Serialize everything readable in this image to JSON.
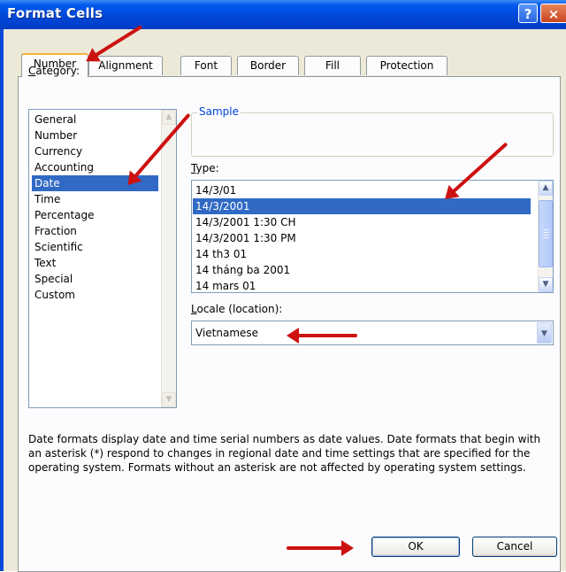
{
  "window": {
    "title": "Format Cells",
    "help_glyph": "?",
    "close_glyph": "×"
  },
  "tabs": [
    {
      "label": "Number",
      "active": true
    },
    {
      "label": "Alignment",
      "active": false
    },
    {
      "label": "Font",
      "active": false
    },
    {
      "label": "Border",
      "active": false
    },
    {
      "label": "Fill",
      "active": false
    },
    {
      "label": "Protection",
      "active": false
    }
  ],
  "category": {
    "label_underlined": "C",
    "label_rest": "ategory:",
    "items": [
      "General",
      "Number",
      "Currency",
      "Accounting",
      "Date",
      "Time",
      "Percentage",
      "Fraction",
      "Scientific",
      "Text",
      "Special",
      "Custom"
    ],
    "selected": "Date"
  },
  "sample": {
    "label": "Sample",
    "value": ""
  },
  "type": {
    "label_underlined": "T",
    "label_rest": "ype:",
    "items": [
      "14/3/01",
      "14/3/2001",
      "14/3/2001 1:30 CH",
      "14/3/2001 1:30 PM",
      "14 th3 01",
      "14 tháng ba 2001",
      "14 mars 01"
    ],
    "selected": "14/3/2001"
  },
  "locale": {
    "label_underlined": "L",
    "label_rest": "ocale (location):",
    "value": "Vietnamese"
  },
  "description": "Date formats display date and time serial numbers as date values.  Date formats that begin with an asterisk (*) respond to changes in regional date and time settings that are specified for the operating system. Formats without an asterisk are not affected by operating system settings.",
  "buttons": {
    "ok": "OK",
    "cancel": "Cancel"
  },
  "colors": {
    "selection": "#316ac5",
    "annotation_arrow": "#cc1111",
    "titlebar": "#0147d6"
  }
}
